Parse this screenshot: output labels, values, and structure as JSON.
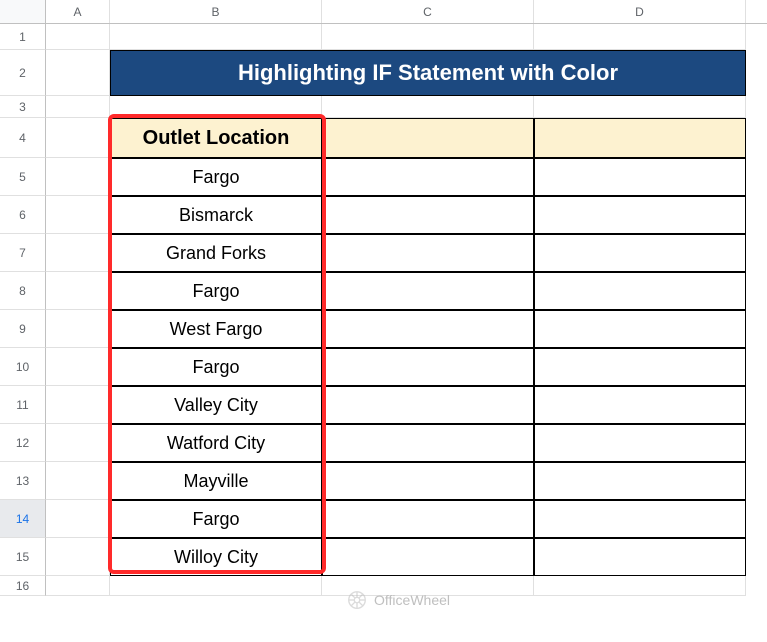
{
  "columns": [
    "A",
    "B",
    "C",
    "D"
  ],
  "rows": [
    "1",
    "2",
    "3",
    "4",
    "5",
    "6",
    "7",
    "8",
    "9",
    "10",
    "11",
    "12",
    "13",
    "14",
    "15",
    "16"
  ],
  "selectedRow": "14",
  "title": "Highlighting IF Statement with Color",
  "tableHeader": "Outlet Location",
  "locations": [
    "Fargo",
    "Bismarck",
    "Grand Forks",
    "Fargo",
    "West Fargo",
    "Fargo",
    "Valley City",
    "Watford City",
    "Mayville",
    "Fargo",
    "Willoy City"
  ],
  "watermark": "OfficeWheel"
}
